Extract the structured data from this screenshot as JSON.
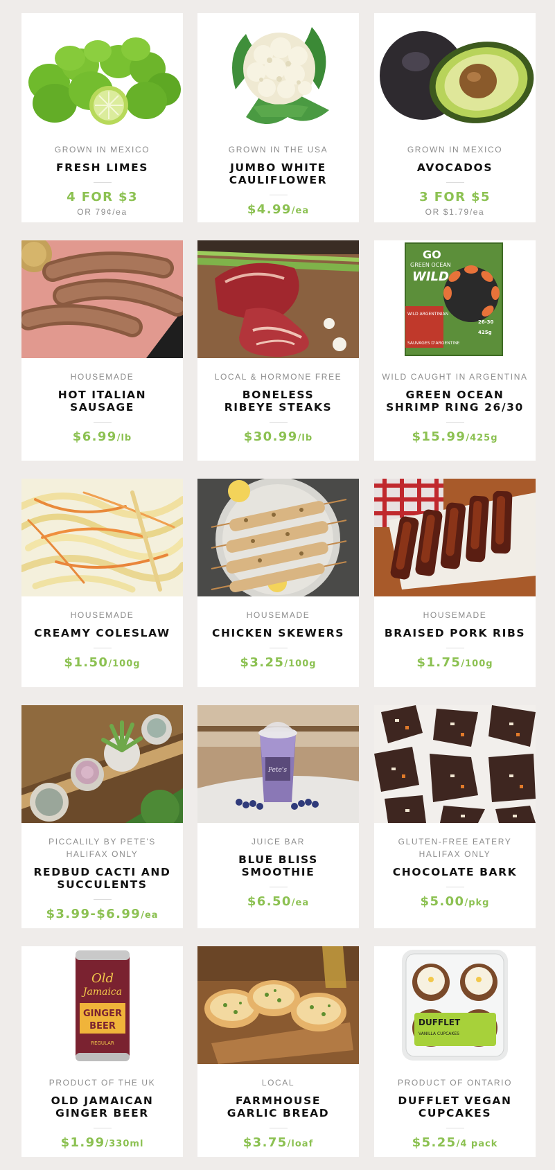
{
  "products": [
    {
      "origin": "GROWN IN MEXICO",
      "name": "FRESH LIMES",
      "price": "4 FOR $3",
      "unit": "",
      "alt": "OR 79¢/ea",
      "image": "limes"
    },
    {
      "origin": "GROWN IN THE USA",
      "name": "JUMBO WHITE\nCAULIFLOWER",
      "price": "$4.99",
      "unit": "/ea",
      "alt": "",
      "image": "cauliflower"
    },
    {
      "origin": "GROWN IN MEXICO",
      "name": "AVOCADOS",
      "price": "3 FOR $5",
      "unit": "",
      "alt": "OR $1.79/ea",
      "image": "avocados"
    },
    {
      "origin": "HOUSEMADE",
      "name": "HOT ITALIAN\nSAUSAGE",
      "price": "$6.99",
      "unit": "/lb",
      "alt": "",
      "image": "sausage"
    },
    {
      "origin": "LOCAL & HORMONE FREE",
      "name": "BONELESS\nRIBEYE STEAKS",
      "price": "$30.99",
      "unit": "/lb",
      "alt": "",
      "image": "ribeye-steaks"
    },
    {
      "origin": "WILD CAUGHT IN ARGENTINA",
      "name": "GREEN OCEAN\nSHRIMP RING 26/30",
      "price": "$15.99",
      "unit": "/425g",
      "alt": "",
      "image": "shrimp-ring-box",
      "package_text": [
        "GO",
        "GREEN OCEAN",
        "WILD",
        "WILD ARGENTINIAN",
        "26-30",
        "425g",
        "SAUVAGES D'ARGENTINE"
      ]
    },
    {
      "origin": "HOUSEMADE",
      "name": "CREAMY COLESLAW",
      "price": "$1.50",
      "unit": "/100g",
      "alt": "",
      "image": "coleslaw"
    },
    {
      "origin": "HOUSEMADE",
      "name": "CHICKEN SKEWERS",
      "price": "$3.25",
      "unit": "/100g",
      "alt": "",
      "image": "chicken-skewers"
    },
    {
      "origin": "HOUSEMADE",
      "name": "BRAISED PORK RIBS",
      "price": "$1.75",
      "unit": "/100g",
      "alt": "",
      "image": "pork-ribs"
    },
    {
      "origin": "PICCALILY BY PETE'S\nHALIFAX ONLY",
      "name": "REDBUD CACTI AND\nSUCCULENTS",
      "price": "$3.99-$6.99",
      "unit": "/ea",
      "alt": "",
      "image": "succulents"
    },
    {
      "origin": "JUICE BAR",
      "name": "BLUE BLISS\nSMOOTHIE",
      "price": "$6.50",
      "unit": "/ea",
      "alt": "",
      "image": "smoothie",
      "package_text": [
        "Pete's"
      ]
    },
    {
      "origin": "GLUTEN-FREE EATERY\nHALIFAX ONLY",
      "name": "CHOCOLATE BARK",
      "price": "$5.00",
      "unit": "/pkg",
      "alt": "",
      "image": "chocolate-bark"
    },
    {
      "origin": "PRODUCT OF THE UK",
      "name": "OLD JAMAICAN\nGINGER BEER",
      "price": "$1.99",
      "unit": "/330ml",
      "alt": "",
      "image": "ginger-beer-can",
      "package_text": [
        "Old",
        "Jamaica",
        "GINGER",
        "BEER",
        "REGULAR"
      ]
    },
    {
      "origin": "LOCAL",
      "name": "FARMHOUSE\nGARLIC BREAD",
      "price": "$3.75",
      "unit": "/loaf",
      "alt": "",
      "image": "garlic-bread"
    },
    {
      "origin": "PRODUCT OF ONTARIO",
      "name": "DUFFLET VEGAN\nCUPCAKES",
      "price": "$5.25",
      "unit": "/4 pack",
      "alt": "",
      "image": "cupcakes-pack",
      "package_text": [
        "DUFFLET",
        "VANILLA CUPCAKES"
      ]
    }
  ],
  "colors": {
    "background": "#efecea",
    "card": "#ffffff",
    "price": "#8cc152",
    "origin": "#8d8d8d",
    "name": "#111111"
  }
}
